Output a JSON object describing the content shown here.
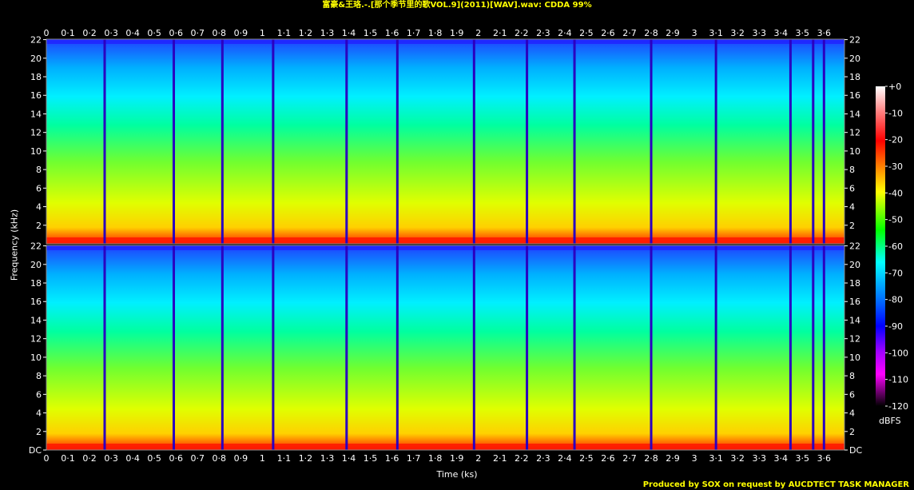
{
  "title": "富豪&王珞.-.[那个季节里的歌VOL.9](2011)[WAV].wav: CDDA 99%",
  "footer": "Produced by SOX on request by AUCDTECT TASK MANAGER",
  "colors": {
    "background": "#000000",
    "title": "#ffff00",
    "footer": "#ffff00",
    "axis_text": "#ffffff",
    "colormap": [
      "#000000",
      "#4b0047",
      "#a000a0",
      "#0000ff",
      "#00ffff",
      "#00ff00",
      "#ffff00",
      "#ff0000",
      "#ffffff"
    ]
  },
  "chart_data": {
    "type": "heatmap",
    "title": "富豪&王珞.-.[那个季节里的歌VOL.9](2011)[WAV].wav: CDDA 99%",
    "xlabel": "Time (ks)",
    "ylabel": "Frequency (kHz)",
    "colorbar_label": "dBFS",
    "x_tick_labels": [
      "0",
      "0·1",
      "0·2",
      "0·3",
      "0·4",
      "0·5",
      "0·6",
      "0·7",
      "0·8",
      "0·9",
      "1",
      "1·1",
      "1·2",
      "1·3",
      "1·4",
      "1·5",
      "1·6",
      "1·7",
      "1·8",
      "1·9",
      "2",
      "2·1",
      "2·2",
      "2·3",
      "2·4",
      "2·5",
      "2·6",
      "2·7",
      "2·8",
      "2·9",
      "3",
      "3·1",
      "3·2",
      "3·3",
      "3·4",
      "3·5",
      "3·6"
    ],
    "xlim": [
      0,
      3.695
    ],
    "ylim": [
      0,
      22.05
    ],
    "y_tick_labels": [
      "DC",
      "2",
      "4",
      "6",
      "8",
      "10",
      "12",
      "14",
      "16",
      "18",
      "20",
      "22"
    ],
    "y_tick_values": [
      0,
      2,
      4,
      6,
      8,
      10,
      12,
      14,
      16,
      18,
      20,
      22
    ],
    "channels": 2,
    "colorbar_ticks": [
      "+0",
      "-10",
      "-20",
      "-30",
      "-40",
      "-50",
      "-60",
      "-70",
      "-80",
      "-90",
      "-100",
      "-110",
      "-120"
    ],
    "colorbar_range": [
      -120,
      0
    ],
    "track_boundaries_ks": [
      0.27,
      0.59,
      0.815,
      1.05,
      1.39,
      1.625,
      1.98,
      2.225,
      2.445,
      2.8,
      3.1,
      3.445,
      3.55,
      3.6
    ]
  }
}
